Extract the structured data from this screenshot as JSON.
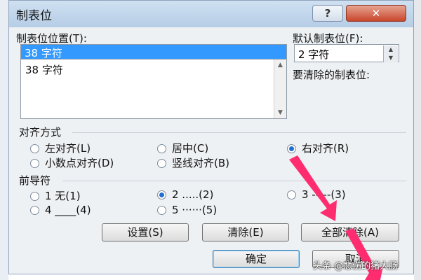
{
  "dialog": {
    "title": "制表位",
    "help_label": "?",
    "close_label": "✕"
  },
  "tab_stop": {
    "label": "制表位位置(T):",
    "value": "38 字符",
    "list": [
      "38 字符"
    ]
  },
  "default_tab": {
    "label": "默认制表位(F):",
    "value": "2 字符"
  },
  "clear_label": "要清除的制表位:",
  "alignment": {
    "group_label": "对齐方式",
    "options": [
      {
        "label": "左对齐(L)",
        "checked": false
      },
      {
        "label": "居中(C)",
        "checked": false
      },
      {
        "label": "右对齐(R)",
        "checked": true
      },
      {
        "label": "小数点对齐(D)",
        "checked": false
      },
      {
        "label": "竖线对齐(B)",
        "checked": false
      }
    ]
  },
  "leader": {
    "group_label": "前导符",
    "options": [
      {
        "label": "1 无(1)",
        "checked": false
      },
      {
        "label": "2 .....(2)",
        "checked": true
      },
      {
        "label": "3 -----(3)",
        "checked": false
      },
      {
        "label": "4 ____(4)",
        "checked": false
      },
      {
        "label": "5 ······(5)",
        "checked": false
      }
    ]
  },
  "buttons": {
    "set": "设置(S)",
    "clear": "清除(E)",
    "clear_all": "全部清除(A)",
    "ok": "确定",
    "cancel": "取消"
  },
  "watermark": "头条 @悲伤的猪大肠",
  "colors": {
    "arrow": "#ff2d6f",
    "selection": "#3399ff",
    "title_bar": "#c3d8ee",
    "close_button": "#c9462c"
  }
}
